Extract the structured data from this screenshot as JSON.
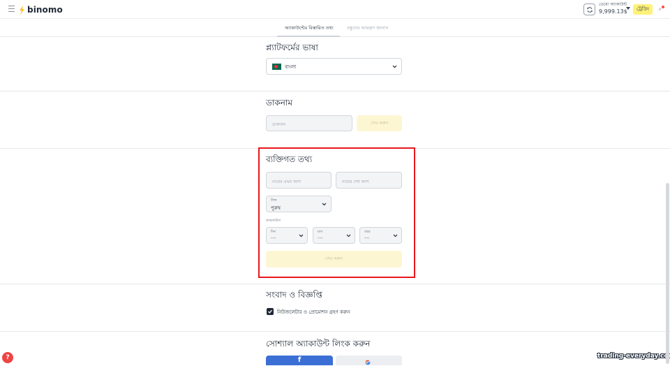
{
  "app": {
    "name": "binomo"
  },
  "account": {
    "type_label": "ডেমো অ্যাকাউন্ট",
    "balance": "9,999.13$",
    "trade_button": "ট্রেডিং",
    "avatar_letter": "P"
  },
  "tabs": [
    {
      "label": "অ্যাকাউন্টের বিস্তারিত তথ্য",
      "active": true
    },
    {
      "label": "বন্ধুদের আমন্ত্রণ জানান",
      "active": false
    }
  ],
  "platform_language": {
    "heading": "প্ল্যাটফর্মের ভাষা",
    "selected": "বাংলা",
    "flag_icon": "bangladesh-flag-icon"
  },
  "nickname": {
    "heading": "ডাকনাম",
    "placeholder": "ডাকনাম",
    "save_label": "সেভ করুন"
  },
  "personal_info": {
    "heading": "ব্যক্তিগত তথ্য",
    "first_name_placeholder": "নামের প্রথম অংশ",
    "last_name_placeholder": "নামের শেষ অংশ",
    "gender_label": "লিঙ্গ",
    "gender_value": "পুরুষ",
    "dob_label": "জন্মতারিখ",
    "day_label": "দিন",
    "day_value": "---",
    "month_label": "মাস",
    "month_value": "---",
    "year_label": "বছর",
    "year_value": "---",
    "save_label": "সেভ করুন"
  },
  "news": {
    "heading": "সংবাদ ও বিজ্ঞপ্তি",
    "checkbox_label": "নিউজলেটার ও প্রোমোশন গ্রহণ করুন",
    "checked": true
  },
  "social": {
    "heading": "সোশ্যাল অ্যাকাউন্ট লিংক করুন",
    "facebook_label": "f"
  },
  "help_icon_glyph": "?",
  "watermark": "trading-everyday.com",
  "colors": {
    "accent_yellow": "#fff27a",
    "highlight_red": "#e8171c",
    "facebook_blue": "#3b6fd6"
  }
}
